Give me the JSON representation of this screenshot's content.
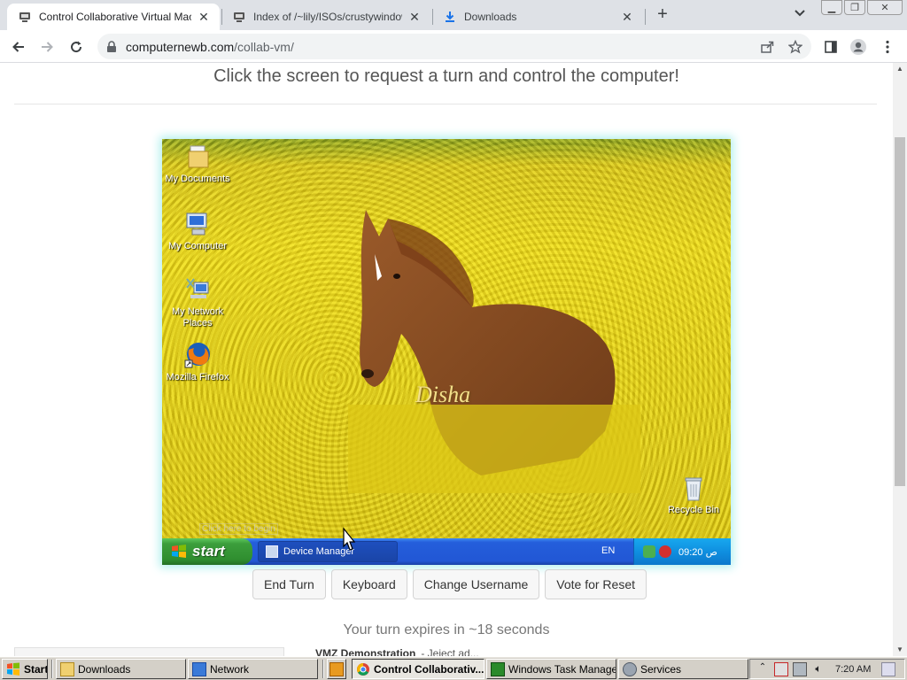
{
  "browser": {
    "tabs": [
      {
        "title": "Control Collaborative Virtual Machin",
        "active": true,
        "icon": "collabvm-icon"
      },
      {
        "title": "Index of /~lily/ISOs/crustywindows/",
        "active": false,
        "icon": "collabvm-icon"
      },
      {
        "title": "Downloads",
        "active": false,
        "icon": "download-icon"
      }
    ],
    "new_tab_label": "+",
    "url_host": "computernewb.com",
    "url_path": "/collab-vm/"
  },
  "page": {
    "headline": "Click the screen to request a turn and control the computer!",
    "buttons": {
      "end_turn": "End Turn",
      "keyboard": "Keyboard",
      "change_username": "Change Username",
      "vote_reset": "Vote for Reset"
    },
    "turn_status": "Your turn expires in ~18 seconds",
    "vm_name": "VMZ Demonstration",
    "vm_name_rest": "- Jeject ad..."
  },
  "vm": {
    "desktop_icons": [
      {
        "label": "My Documents",
        "icon": "folder-icon"
      },
      {
        "label": "My Computer",
        "icon": "computer-icon"
      },
      {
        "label": "My Network Places",
        "icon": "network-icon"
      },
      {
        "label": "Mozilla Firefox",
        "icon": "firefox-icon"
      },
      {
        "label": "Recycle Bin",
        "icon": "recycle-bin-icon"
      }
    ],
    "wallpaper_text": "Disha",
    "click_hint": "Click here to begin",
    "start_label": "start",
    "task_button": "Device Manager",
    "language": "EN",
    "clock": "09:20 ص"
  },
  "host_taskbar": {
    "start": "Start",
    "items": [
      {
        "label": "Downloads",
        "pressed": false
      },
      {
        "label": "Network",
        "pressed": false
      },
      {
        "label": "Control Collaborativ...",
        "pressed": true
      },
      {
        "label": "Windows Task Manager",
        "pressed": false
      },
      {
        "label": "Services",
        "pressed": false
      }
    ],
    "clock": "7:20 AM"
  },
  "colors": {
    "chrome_tabstrip": "#dee1e6",
    "xp_taskbar": "#245edb",
    "xp_start": "#3c9e3c",
    "vm_glow": "#b4f0ee",
    "host_taskbar": "#d4d0c8"
  }
}
